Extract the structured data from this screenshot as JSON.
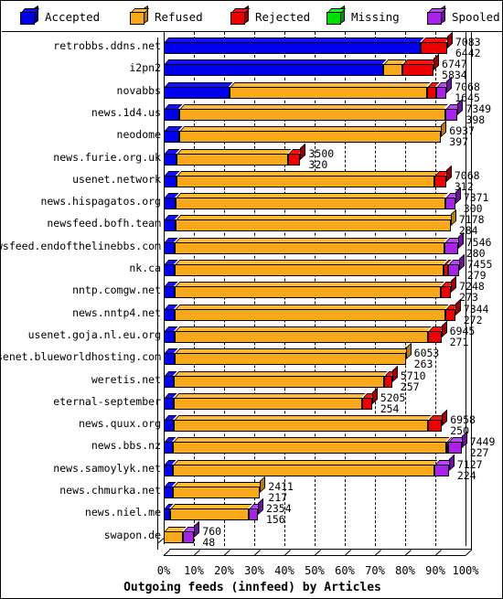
{
  "legend": {
    "items": [
      {
        "label": "Accepted",
        "color": "#0000EE",
        "side": "#000099",
        "top": "#1111FF"
      },
      {
        "label": "Refused",
        "color": "#F7A81B",
        "side": "#B57A10",
        "top": "#FFBB33"
      },
      {
        "label": "Rejected",
        "color": "#EE0000",
        "side": "#990000",
        "top": "#FF1111"
      },
      {
        "label": "Missing",
        "color": "#00DD00",
        "side": "#009900",
        "top": "#11FF11"
      },
      {
        "label": "Spooled",
        "color": "#A822E8",
        "side": "#6E109E",
        "top": "#BB44FF"
      }
    ]
  },
  "chart_data": {
    "type": "bar",
    "title": "Outgoing feeds (innfeed) by Articles",
    "xlabel": "Outgoing feeds (innfeed) by Articles",
    "ylabel": "",
    "orientation": "horizontal",
    "stacked": true,
    "grid": true,
    "legend_position": "top",
    "xlim": [
      0,
      100
    ],
    "xunit": "%",
    "xticks": [
      0,
      10,
      20,
      30,
      40,
      50,
      60,
      70,
      80,
      90,
      100
    ],
    "xticklabels": [
      "0%",
      "10%",
      "20%",
      "30%",
      "40%",
      "50%",
      "60%",
      "70%",
      "80%",
      "90%",
      "100%"
    ],
    "max_total": 7546,
    "series_names": [
      "Accepted",
      "Refused",
      "Rejected",
      "Missing",
      "Spooled"
    ],
    "categories": [
      "retrobbs.ddns.net",
      "i2pn2",
      "novabbs",
      "news.1d4.us",
      "neodome",
      "news.furie.org.uk",
      "usenet.network",
      "news.hispagatos.org",
      "newsfeed.bofh.team",
      "newsfeed.endofthelinebbs.com",
      "nk.ca",
      "nntp.comgw.net",
      "news.nntp4.net",
      "usenet.goja.nl.eu.org",
      "usenet.blueworldhosting.com",
      "weretis.net",
      "eternal-september",
      "news.quux.org",
      "news.bbs.nz",
      "news.samoylyk.net",
      "news.chmurka.net",
      "news.niel.me",
      "swapon.de"
    ],
    "rows": [
      {
        "label": "retrobbs.ddns.net",
        "total": 7083,
        "value2": 6442,
        "segments": [
          {
            "s": "Accepted",
            "pct": 85.3
          },
          {
            "s": "Rejected",
            "pct": 8.6
          }
        ]
      },
      {
        "label": "i2pn2",
        "total": 6747,
        "value2": 5834,
        "segments": [
          {
            "s": "Accepted",
            "pct": 72.8
          },
          {
            "s": "Refused",
            "pct": 6.4
          },
          {
            "s": "Rejected",
            "pct": 10.2
          }
        ]
      },
      {
        "label": "novabbs",
        "total": 7068,
        "value2": 1645,
        "segments": [
          {
            "s": "Accepted",
            "pct": 21.8
          },
          {
            "s": "Refused",
            "pct": 65.6
          },
          {
            "s": "Rejected",
            "pct": 3.0
          },
          {
            "s": "Spooled",
            "pct": 3.3
          }
        ]
      },
      {
        "label": "news.1d4.us",
        "total": 7349,
        "value2": 398,
        "segments": [
          {
            "s": "Accepted",
            "pct": 5.3
          },
          {
            "s": "Refused",
            "pct": 87.9
          },
          {
            "s": "Spooled",
            "pct": 4.2
          }
        ]
      },
      {
        "label": "neodome",
        "total": 6937,
        "value2": 397,
        "segments": [
          {
            "s": "Accepted",
            "pct": 5.2
          },
          {
            "s": "Refused",
            "pct": 86.7
          }
        ]
      },
      {
        "label": "news.furie.org.uk",
        "total": 3500,
        "value2": 320,
        "segments": [
          {
            "s": "Accepted",
            "pct": 4.2
          },
          {
            "s": "Refused",
            "pct": 37.1
          },
          {
            "s": "Rejected",
            "pct": 4.0
          }
        ]
      },
      {
        "label": "usenet.network",
        "total": 7068,
        "value2": 312,
        "segments": [
          {
            "s": "Accepted",
            "pct": 4.1
          },
          {
            "s": "Refused",
            "pct": 85.7
          },
          {
            "s": "Rejected",
            "pct": 3.8
          }
        ]
      },
      {
        "label": "news.hispagatos.org",
        "total": 7371,
        "value2": 300,
        "segments": [
          {
            "s": "Accepted",
            "pct": 4.0
          },
          {
            "s": "Refused",
            "pct": 89.2
          },
          {
            "s": "Spooled",
            "pct": 3.4
          }
        ]
      },
      {
        "label": "newsfeed.bofh.team",
        "total": 7178,
        "value2": 284,
        "segments": [
          {
            "s": "Accepted",
            "pct": 3.8
          },
          {
            "s": "Refused",
            "pct": 91.3
          }
        ]
      },
      {
        "label": "newsfeed.endofthelinebbs.com",
        "total": 7546,
        "value2": 280,
        "segments": [
          {
            "s": "Accepted",
            "pct": 3.7
          },
          {
            "s": "Refused",
            "pct": 89.3
          },
          {
            "s": "Spooled",
            "pct": 4.5
          }
        ]
      },
      {
        "label": "nk.ca",
        "total": 7455,
        "value2": 279,
        "segments": [
          {
            "s": "Accepted",
            "pct": 3.7
          },
          {
            "s": "Refused",
            "pct": 89.1
          },
          {
            "s": "Rejected",
            "pct": 1.5
          },
          {
            "s": "Spooled",
            "pct": 3.5
          }
        ]
      },
      {
        "label": "nntp.comgw.net",
        "total": 7248,
        "value2": 273,
        "segments": [
          {
            "s": "Accepted",
            "pct": 3.6
          },
          {
            "s": "Refused",
            "pct": 88.2
          },
          {
            "s": "Rejected",
            "pct": 3.4
          }
        ]
      },
      {
        "label": "news.nntp4.net",
        "total": 7344,
        "value2": 272,
        "segments": [
          {
            "s": "Accepted",
            "pct": 3.6
          },
          {
            "s": "Refused",
            "pct": 89.6
          },
          {
            "s": "Rejected",
            "pct": 3.4
          }
        ]
      },
      {
        "label": "usenet.goja.nl.eu.org",
        "total": 6945,
        "value2": 271,
        "segments": [
          {
            "s": "Accepted",
            "pct": 3.6
          },
          {
            "s": "Refused",
            "pct": 84.0
          },
          {
            "s": "Rejected",
            "pct": 4.4
          }
        ]
      },
      {
        "label": "usenet.blueworldhosting.com",
        "total": 6053,
        "value2": 263,
        "segments": [
          {
            "s": "Accepted",
            "pct": 3.5
          },
          {
            "s": "Refused",
            "pct": 76.7
          }
        ]
      },
      {
        "label": "weretis.net",
        "total": 5710,
        "value2": 257,
        "segments": [
          {
            "s": "Accepted",
            "pct": 3.4
          },
          {
            "s": "Refused",
            "pct": 69.7
          },
          {
            "s": "Rejected",
            "pct": 2.6
          }
        ]
      },
      {
        "label": "eternal-september",
        "total": 5205,
        "value2": 254,
        "segments": [
          {
            "s": "Accepted",
            "pct": 3.4
          },
          {
            "s": "Refused",
            "pct": 62.4
          },
          {
            "s": "Rejected",
            "pct": 3.2
          }
        ]
      },
      {
        "label": "news.quux.org",
        "total": 6958,
        "value2": 250,
        "segments": [
          {
            "s": "Accepted",
            "pct": 3.3
          },
          {
            "s": "Refused",
            "pct": 84.2
          },
          {
            "s": "Rejected",
            "pct": 4.7
          }
        ]
      },
      {
        "label": "news.bbs.nz",
        "total": 7449,
        "value2": 227,
        "segments": [
          {
            "s": "Accepted",
            "pct": 3.0
          },
          {
            "s": "Refused",
            "pct": 90.6
          },
          {
            "s": "Rejected",
            "pct": 0.7
          },
          {
            "s": "Spooled",
            "pct": 4.4
          }
        ]
      },
      {
        "label": "news.samoylyk.net",
        "total": 7127,
        "value2": 224,
        "segments": [
          {
            "s": "Accepted",
            "pct": 3.0
          },
          {
            "s": "Refused",
            "pct": 86.6
          },
          {
            "s": "Spooled",
            "pct": 4.9
          }
        ]
      },
      {
        "label": "news.chmurka.net",
        "total": 2411,
        "value2": 217,
        "segments": [
          {
            "s": "Accepted",
            "pct": 2.9
          },
          {
            "s": "Refused",
            "pct": 29.0
          }
        ]
      },
      {
        "label": "news.niel.me",
        "total": 2354,
        "value2": 156,
        "segments": [
          {
            "s": "Accepted",
            "pct": 2.1
          },
          {
            "s": "Refused",
            "pct": 26.0
          },
          {
            "s": "Spooled",
            "pct": 3.1
          }
        ]
      },
      {
        "label": "swapon.de",
        "total": 760,
        "value2": 48,
        "segments": [
          {
            "s": "Refused",
            "pct": 6.4
          },
          {
            "s": "Spooled",
            "pct": 3.7
          }
        ]
      }
    ]
  }
}
